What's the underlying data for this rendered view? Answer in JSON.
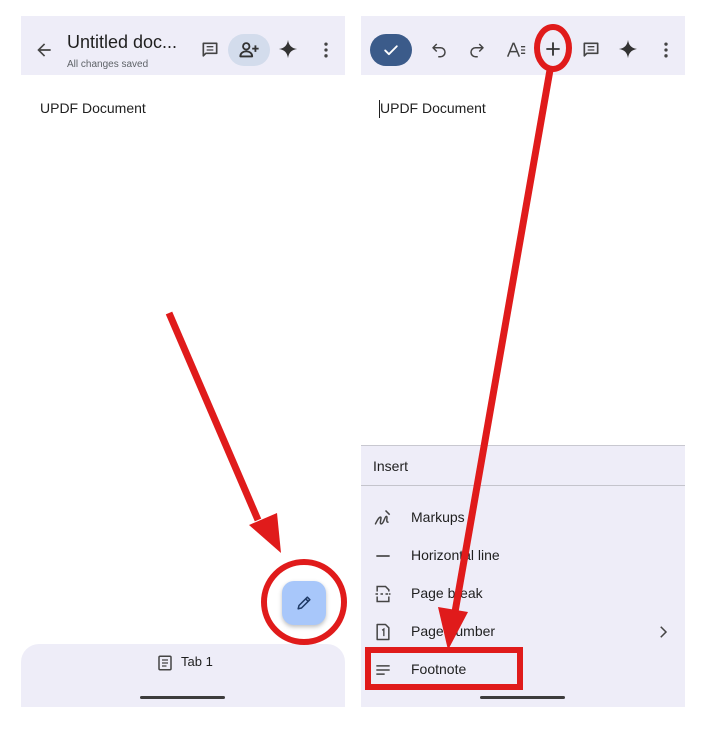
{
  "left_screen": {
    "title": "Untitled doc...",
    "save_status": "All changes saved",
    "doc_text": "UPDF Document",
    "tab_label": "Tab 1",
    "icons": [
      "back-arrow-icon",
      "comment-icon",
      "share-icon",
      "gemini-sparkle-icon",
      "more-vert-icon",
      "edit-pencil-icon",
      "document-icon"
    ]
  },
  "right_screen": {
    "doc_text": "UPDF Document",
    "insert_menu": {
      "title": "Insert",
      "items": [
        {
          "label": "Markups",
          "icon": "markup-icon"
        },
        {
          "label": "Horizontal line",
          "icon": "horizontal-line-icon"
        },
        {
          "label": "Page break",
          "icon": "page-break-icon"
        },
        {
          "label": "Page number",
          "icon": "page-number-icon"
        },
        {
          "label": "Footnote",
          "icon": "footnote-icon"
        }
      ]
    },
    "icons": [
      "done-check-icon",
      "undo-icon",
      "redo-icon",
      "text-format-icon",
      "insert-plus-icon",
      "comment-icon",
      "gemini-sparkle-icon",
      "more-vert-icon",
      "chevron-right-icon"
    ]
  },
  "colors": {
    "toolbar_bg": "#eeedf8",
    "fab_bg": "#a8c7fa",
    "done_button_bg": "#3b5b8a",
    "annotation_red": "#e01b1b"
  }
}
